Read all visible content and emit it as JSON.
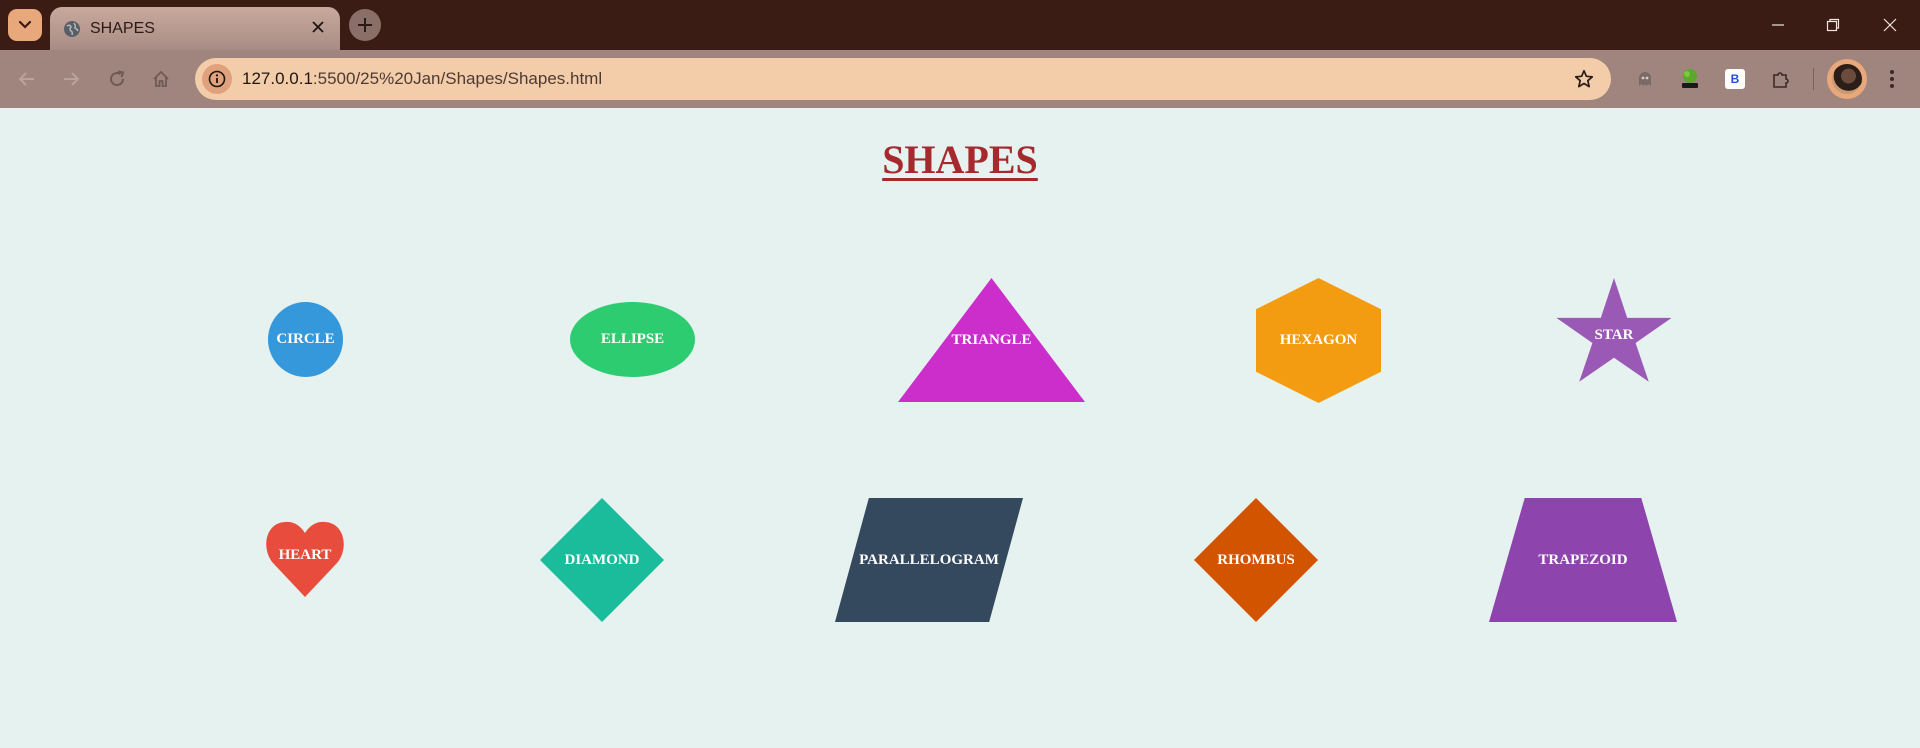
{
  "browser": {
    "tab": {
      "title": "SHAPES",
      "icon": "globe-icon"
    },
    "address": {
      "host": "127.0.0.1",
      "path": ":5500/25%20Jan/Shapes/Shapes.html"
    },
    "extensions": {
      "b_badge": "B"
    }
  },
  "page": {
    "title": "SHAPES",
    "shapes": [
      {
        "label": "CIRCLE",
        "color": "#3498db"
      },
      {
        "label": "ELLIPSE",
        "color": "#2ecc71"
      },
      {
        "label": "TRIANGLE",
        "color": "#cc2ecc"
      },
      {
        "label": "HEXAGON",
        "color": "#f39c12"
      },
      {
        "label": "STAR",
        "color": "#9b59b6"
      },
      {
        "label": "HEART",
        "color": "#e74c3c"
      },
      {
        "label": "DIAMOND",
        "color": "#1abc9c"
      },
      {
        "label": "PARALLELOGRAM",
        "color": "#34495e"
      },
      {
        "label": "RHOMBUS",
        "color": "#d35400"
      },
      {
        "label": "TRAPEZOID",
        "color": "#8e44ad"
      }
    ]
  },
  "colors": {
    "title": "#a6292e",
    "background": "#e6f2ef",
    "tabbar": "#3a1c14",
    "toolbar": "#9f857d",
    "omnibox": "#f3cdaa"
  }
}
